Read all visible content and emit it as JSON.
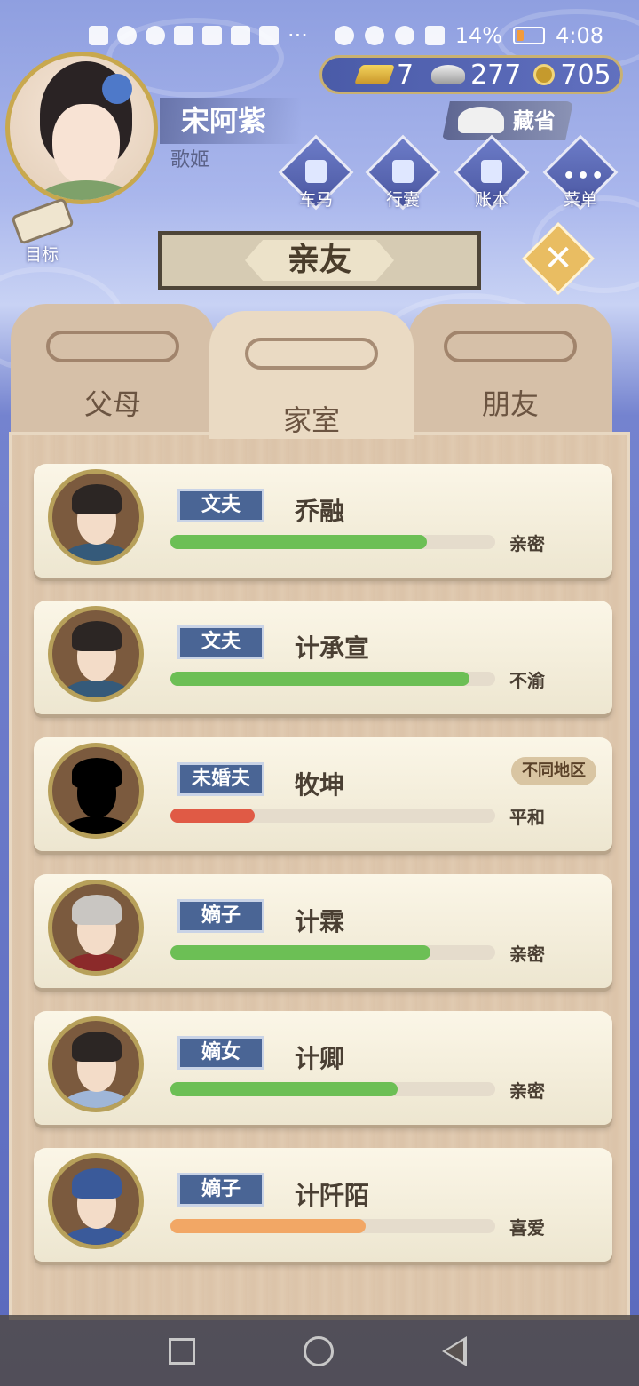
{
  "status_bar": {
    "battery_percent": "14%",
    "time": "4:08",
    "more": "···"
  },
  "player": {
    "name": "宋阿紫",
    "title": "歌姬"
  },
  "currency": {
    "gold": "7",
    "silver": "277",
    "coins": "705"
  },
  "collect_button": "藏省",
  "menu": [
    {
      "label": "车马"
    },
    {
      "label": "行囊"
    },
    {
      "label": "账本"
    },
    {
      "label": "菜单"
    }
  ],
  "goal_label": "目标",
  "page_title": "亲友",
  "close_symbol": "✕",
  "tabs": [
    {
      "label": "父母",
      "active": false
    },
    {
      "label": "家室",
      "active": true
    },
    {
      "label": "朋友",
      "active": false
    }
  ],
  "relatives": [
    {
      "role": "文夫",
      "name": "乔融",
      "relation": "亲密",
      "affection": 0.79,
      "bar_color": "#6cbf55",
      "badge": ""
    },
    {
      "role": "文夫",
      "name": "计承宣",
      "relation": "不渝",
      "affection": 0.92,
      "bar_color": "#6cbf55",
      "badge": ""
    },
    {
      "role": "未婚夫",
      "name": "牧坤",
      "relation": "平和",
      "affection": 0.26,
      "bar_color": "#e05a45",
      "badge": "不同地区"
    },
    {
      "role": "嫡子",
      "name": "计霖",
      "relation": "亲密",
      "affection": 0.8,
      "bar_color": "#6cbf55",
      "badge": ""
    },
    {
      "role": "嫡女",
      "name": "计卿",
      "relation": "亲密",
      "affection": 0.7,
      "bar_color": "#6cbf55",
      "badge": ""
    },
    {
      "role": "嫡子",
      "name": "计阡陌",
      "relation": "喜爱",
      "affection": 0.6,
      "bar_color": "#f2a765",
      "badge": ""
    }
  ]
}
